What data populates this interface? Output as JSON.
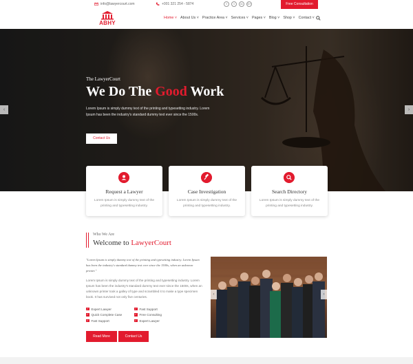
{
  "topbar": {
    "email": "info@lawyercourt.com",
    "phone": "+001 321 254 - 5874",
    "socials": [
      "f",
      "t",
      "in",
      "G+"
    ],
    "social_icons": [
      "facebook-icon",
      "twitter-icon",
      "linkedin-icon",
      "google-plus-icon"
    ],
    "cta": "Free Consultation"
  },
  "header": {
    "logo_text": "ABHY",
    "nav": [
      {
        "label": "Home",
        "active": true
      },
      {
        "label": "About Us"
      },
      {
        "label": "Practice Area"
      },
      {
        "label": "Services"
      },
      {
        "label": "Pages"
      },
      {
        "label": "Blog"
      },
      {
        "label": "Shop"
      },
      {
        "label": "Contact"
      }
    ]
  },
  "hero": {
    "subtitle": "The LawyerCourt",
    "title_pre": "We Do The ",
    "title_highlight": "Good",
    "title_post": " Work",
    "description": "Lorem Ipsum is simply dummy text of the printing and typesetting industry. Lorem Ipsum has been the industry's standard dummy text ever since the 1500s.",
    "button": "Contact Us",
    "prev": "‹",
    "next": "›"
  },
  "cards": [
    {
      "title": "Request a Lawyer",
      "desc": "Lorem Ipsum is simply dummy text of the printing and typesetting industry.",
      "icon": "person-icon"
    },
    {
      "title": "Case Investigation",
      "desc": "Lorem Ipsum is simply dummy text of the printing and typesetting industry.",
      "icon": "gavel-icon"
    },
    {
      "title": "Search Directory",
      "desc": "Lorem Ipsum is simply dummy text of the printing and typesetting industry.",
      "icon": "search-icon"
    }
  ],
  "about": {
    "subtitle": "Who We Are",
    "title_pre": "Welcome to ",
    "title_highlight": "LawyerCourt",
    "quote": "\"Lorem Ipsum is simply dummy text of the printing and typesetting industry. Lorem Ipsum has been the industry's standard dummy text ever since the 1500s, when an unknown printer.\"",
    "paragraph": "Lorem Ipsum is simply dummy text of the printing and typesetting industry. Lorem Ipsum has been the industry's standard dummy text ever since the 1500s, when an unknown printer took a galley of type and scrambled it to make a type specimen book. It has survived not only five centuries.",
    "features": [
      "Expert Lawyer",
      "Fast Support",
      "Quick Complete Case",
      "Free Consulting",
      "Fast Support",
      "Expert Lawyer"
    ],
    "read_more": "Read More",
    "contact": "Contact Us",
    "photo_prev": "‹",
    "photo_next": "›"
  },
  "colors": {
    "accent": "#e21b2e"
  }
}
